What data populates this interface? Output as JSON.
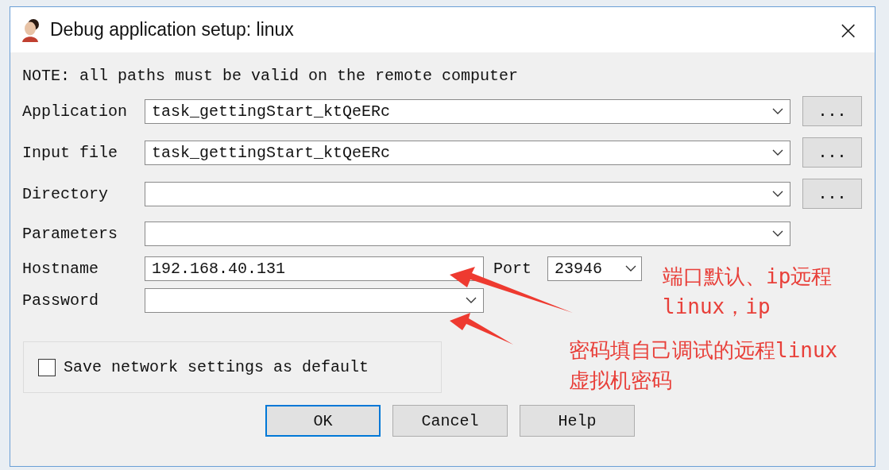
{
  "window": {
    "title": "Debug application setup: linux",
    "close": "×"
  },
  "note": "NOTE: all paths must be valid on the remote computer",
  "fields": [
    {
      "label": "Application",
      "value": "task_gettingStart_ktQeERc",
      "browse": "..."
    },
    {
      "label": "Input file",
      "value": "task_gettingStart_ktQeERc",
      "browse": "..."
    },
    {
      "label": "Directory",
      "browse": "..."
    },
    {
      "label": "Parameters"
    }
  ],
  "hostname": {
    "label": "Hostname",
    "value": "192.168.40.131"
  },
  "port": {
    "label": "Port",
    "value": "23946"
  },
  "password": {
    "label": "Password"
  },
  "save_default": {
    "label": "Save network settings as default",
    "checked": false
  },
  "buttons": [
    {
      "label": "OK",
      "default": true
    },
    {
      "label": "Cancel",
      "default": false
    },
    {
      "label": "Help",
      "default": false
    }
  ],
  "annotations": [
    "端口默认、ip远程\nlinux，ip",
    "密码填自己调试的远程linux\n虚拟机密码"
  ]
}
